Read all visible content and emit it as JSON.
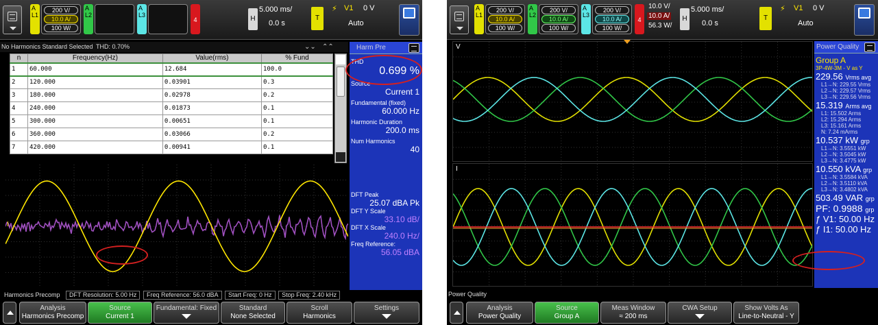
{
  "left": {
    "chan": {
      "a": "A",
      "l1": "L1",
      "l2": "L2",
      "l3": "L3",
      "ch4": "4"
    },
    "ch1": {
      "v1": "200 V/",
      "v2": "10.0 A/",
      "v3": "100 W/"
    },
    "timebase": "5.000 ms/",
    "delay": "0.0 s",
    "h": "H",
    "t": "T",
    "trig_src": "V1",
    "trig_level": "0 V",
    "trig_mode": "Auto",
    "table_bar": {
      "standard": "No Harmonics Standard Selected",
      "thd": "THD: 0.70%"
    },
    "table": {
      "headers": [
        "n",
        "Frequency(Hz)",
        "Value(rms)",
        "% Fund"
      ],
      "rows": [
        [
          "1",
          "60.000",
          "12.684",
          "100.0"
        ],
        [
          "2",
          "120.000",
          "0.03901",
          "0.3"
        ],
        [
          "3",
          "180.000",
          "0.02978",
          "0.2"
        ],
        [
          "4",
          "240.000",
          "0.01873",
          "0.1"
        ],
        [
          "5",
          "300.000",
          "0.00651",
          "0.1"
        ],
        [
          "6",
          "360.000",
          "0.03066",
          "0.2"
        ],
        [
          "7",
          "420.000",
          "0.00941",
          "0.1"
        ]
      ]
    },
    "side": {
      "header": "Harm Pre",
      "thd_label": "THD",
      "thd_value": "0.699 %",
      "source_label": "Source",
      "source_value": "Current 1",
      "fund_label": "Fundamental (fixed)",
      "fund_value": "60.000 Hz",
      "dur_label": "Harmonic Duration",
      "dur_value": "200.0 ms",
      "num_label": "Num Harmonics",
      "num_value": "40",
      "dftpk_label": "DFT Peak",
      "dftpk_value": "25.07 dBA Pk",
      "dfty_label": "DFT Y Scale",
      "dfty_value": "33.10 dB/",
      "dftx_label": "DFT X Scale",
      "dftx_value": "240.0 Hz/",
      "fref_label": "Freq Reference:",
      "fref_value": "56.05 dBA"
    },
    "status": {
      "title": "Harmonics Precomp",
      "dft_res": "DFT Resolution: 5.00 Hz",
      "freq_ref": "Freq Reference: 56.0 dBA",
      "start": "Start Freq: 0 Hz",
      "stop": "Stop Freq: 2.40 kHz"
    },
    "softkeys": [
      {
        "l1": "Analysis",
        "l2": "Harmonics Precomp"
      },
      {
        "l1": "Source",
        "l2": "Current 1"
      },
      {
        "l1": "Fundamental: Fixed",
        "l2": ""
      },
      {
        "l1": "Standard",
        "l2": "None Selected"
      },
      {
        "l1": "Scroll",
        "l2": "Harmonics"
      },
      {
        "l1": "Settings",
        "l2": ""
      }
    ],
    "marker_i": "I"
  },
  "right": {
    "chan": {
      "a": "A",
      "l1": "L1",
      "l2": "L2",
      "l3": "L3",
      "ch4": "4"
    },
    "c1": {
      "v1": "200 V/",
      "v2": "10.0 A/",
      "v3": "100 W/"
    },
    "c2": {
      "v1": "200 V/",
      "v2": "10.0 A/",
      "v3": "100 W/"
    },
    "c3": {
      "v1": "200 V/",
      "v2": "10.0 A/",
      "v3": "100 W/"
    },
    "c4": {
      "v1": "10.0 V/",
      "v2": "10.0 A/",
      "v3": "56.3 W/"
    },
    "timebase": "5.000 ms/",
    "delay": "0.0 s",
    "h": "H",
    "t": "T",
    "trig_src": "V1",
    "trig_level": "0 V",
    "trig_mode": "Auto",
    "plot_v": "V",
    "plot_i": "I",
    "side": {
      "header": "Power Quality",
      "group": "Group A",
      "config": "3P-4W-3M - V as Y",
      "vrms": "229.56",
      "vrms_unit": "Vrms avg",
      "vrms_sub": [
        "L1→N: 229.55 Vrms",
        "L2→N: 229.57 Vrms",
        "L3→N: 229.56 Vrms"
      ],
      "arms": "15.319",
      "arms_unit": "Arms avg",
      "arms_sub": [
        "L1: 15.502 Arms",
        "L2: 15.294 Arms",
        "L3: 15.161 Arms",
        "N: 7.24 mArms"
      ],
      "kw": "10.537 kW",
      "kw_unit": "grp",
      "kw_sub": [
        "L1→N: 3.5551 kW",
        "L2→N: 3.5045 kW",
        "L3→N: 3.4775 kW"
      ],
      "kva": "10.550 kVA",
      "kva_unit": "grp",
      "kva_sub": [
        "L1→N: 3.5584 kVA",
        "L2→N: 3.5110 kVA",
        "L3→N: 3.4802 kVA"
      ],
      "var": "503.49 VAR",
      "var_unit": "grp",
      "pf": "PF: 0.9988",
      "pf_unit": "grp",
      "fv": "ƒ V1: 50.00 Hz",
      "fi": "ƒ I1: 50.00 Hz"
    },
    "status": {
      "title": "Power Quality"
    },
    "softkeys": [
      {
        "l1": "Analysis",
        "l2": "Power Quality"
      },
      {
        "l1": "Source",
        "l2": "Group A"
      },
      {
        "l1": "Meas Window",
        "l2": "≈ 200 ms"
      },
      {
        "l1": "CWA Setup",
        "l2": ""
      },
      {
        "l1": "Show Volts As",
        "l2": "Line-to-Neutral - Y"
      }
    ]
  }
}
